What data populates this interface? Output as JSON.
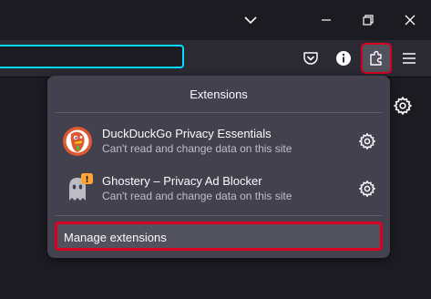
{
  "panel": {
    "title": "Extensions",
    "extensions": [
      {
        "name": "DuckDuckGo Privacy Essentials",
        "description": "Can't read and change data on this site",
        "icon": "duckduckgo-icon"
      },
      {
        "name": "Ghostery – Privacy Ad Blocker",
        "description": "Can't read and change data on this site",
        "icon": "ghostery-icon",
        "badge": "!"
      }
    ],
    "manage_label": "Manage extensions"
  },
  "colors": {
    "highlight": "#d70022",
    "urlbar_focus": "#00ddff",
    "panel_bg": "#42414d"
  }
}
